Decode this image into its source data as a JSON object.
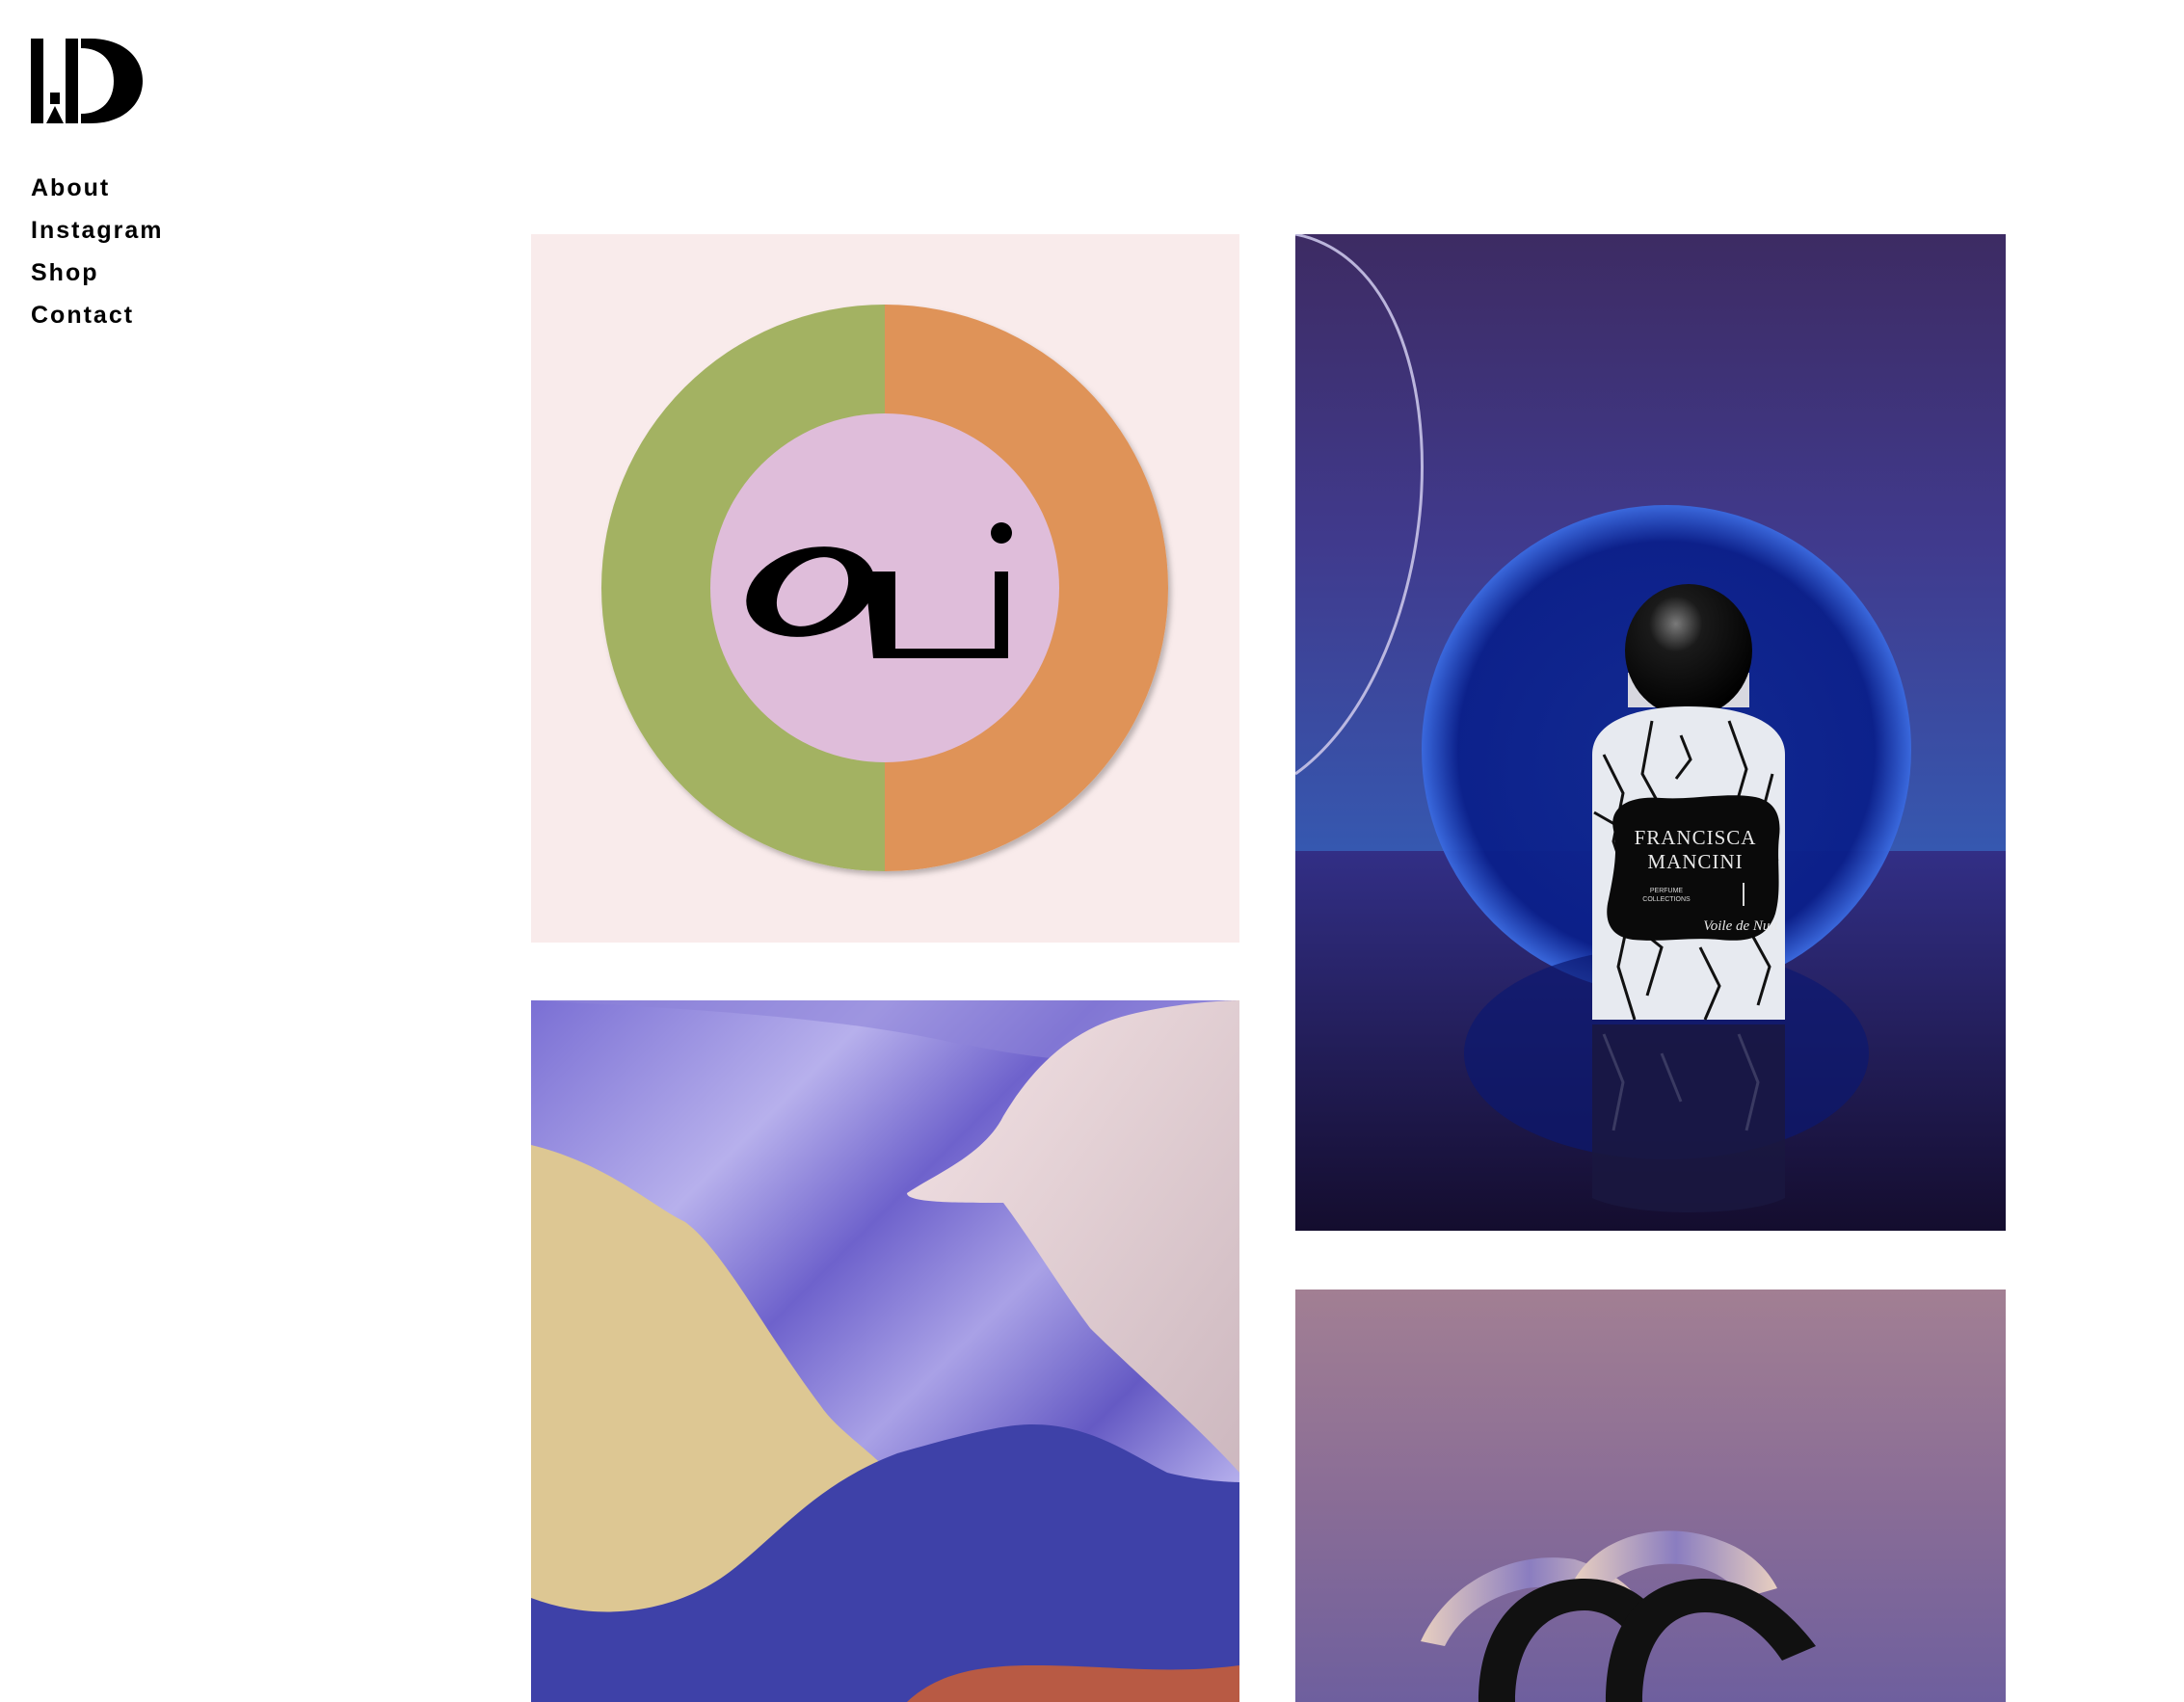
{
  "logo": {
    "text": "I:D"
  },
  "nav": {
    "items": [
      {
        "label": "About"
      },
      {
        "label": "Instagram"
      },
      {
        "label": "Shop"
      },
      {
        "label": "Contact"
      }
    ]
  },
  "gallery": {
    "oli": {
      "mark": "OLi"
    },
    "perfume": {
      "brand_line1": "FRANCISCA",
      "brand_line2": "MANCINI",
      "collection_line1": "PERFUME",
      "collection_line2": "COLLECTIONS",
      "name": "Voile de Nuit"
    }
  }
}
